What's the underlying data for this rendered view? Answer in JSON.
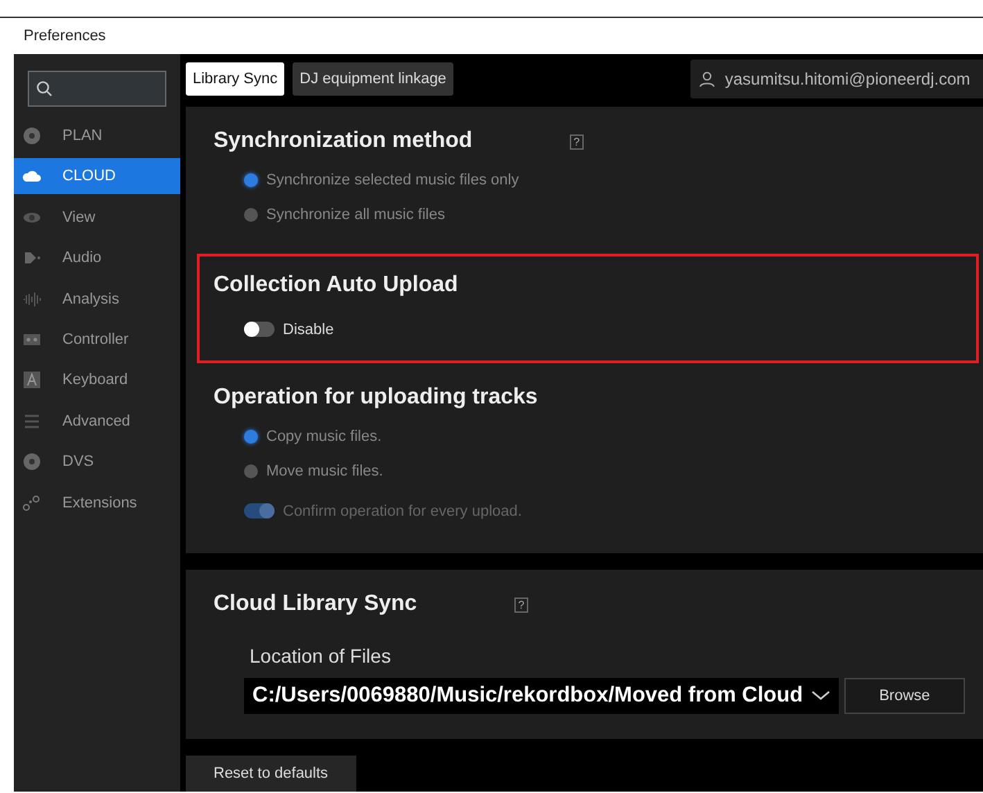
{
  "window": {
    "title": "Preferences"
  },
  "sidebar": {
    "items": [
      {
        "label": "PLAN",
        "selected": false
      },
      {
        "label": "CLOUD",
        "selected": true
      },
      {
        "label": "View",
        "selected": false
      },
      {
        "label": "Audio",
        "selected": false
      },
      {
        "label": "Analysis",
        "selected": false
      },
      {
        "label": "Controller",
        "selected": false
      },
      {
        "label": "Keyboard",
        "selected": false
      },
      {
        "label": "Advanced",
        "selected": false
      },
      {
        "label": "DVS",
        "selected": false
      },
      {
        "label": "Extensions",
        "selected": false
      }
    ]
  },
  "tabs": [
    {
      "label": "Library Sync",
      "selected": true
    },
    {
      "label": "DJ equipment linkage",
      "selected": false
    }
  ],
  "account": {
    "email": "yasumitsu.hitomi@pioneerdj.com"
  },
  "panels": [
    {
      "sections": [
        {
          "kind": "radios",
          "title": "Synchronization method",
          "help": "?",
          "options": [
            {
              "label": "Synchronize selected music files only",
              "selected": true
            },
            {
              "label": "Synchronize all music files",
              "selected": false
            }
          ]
        },
        {
          "kind": "toggle",
          "title": "Collection Auto Upload",
          "highlighted": true,
          "toggle": {
            "label": "Disable",
            "on": false,
            "disabled": false
          }
        },
        {
          "kind": "radios",
          "title": "Operation for uploading tracks",
          "options": [
            {
              "label": "Copy music files.",
              "selected": true
            },
            {
              "label": "Move music files.",
              "selected": false
            }
          ],
          "toggle": {
            "label": "Confirm operation for every upload.",
            "on": true,
            "disabled": true
          }
        }
      ]
    },
    {
      "sections": [
        {
          "kind": "location",
          "title": "Cloud Library Sync",
          "help": "?",
          "label": "Location of Files",
          "path": "C:/Users/0069880/Music/rekordbox/Moved from Cloud",
          "button": "Browse"
        }
      ]
    }
  ],
  "reset_button": "Reset to defaults"
}
